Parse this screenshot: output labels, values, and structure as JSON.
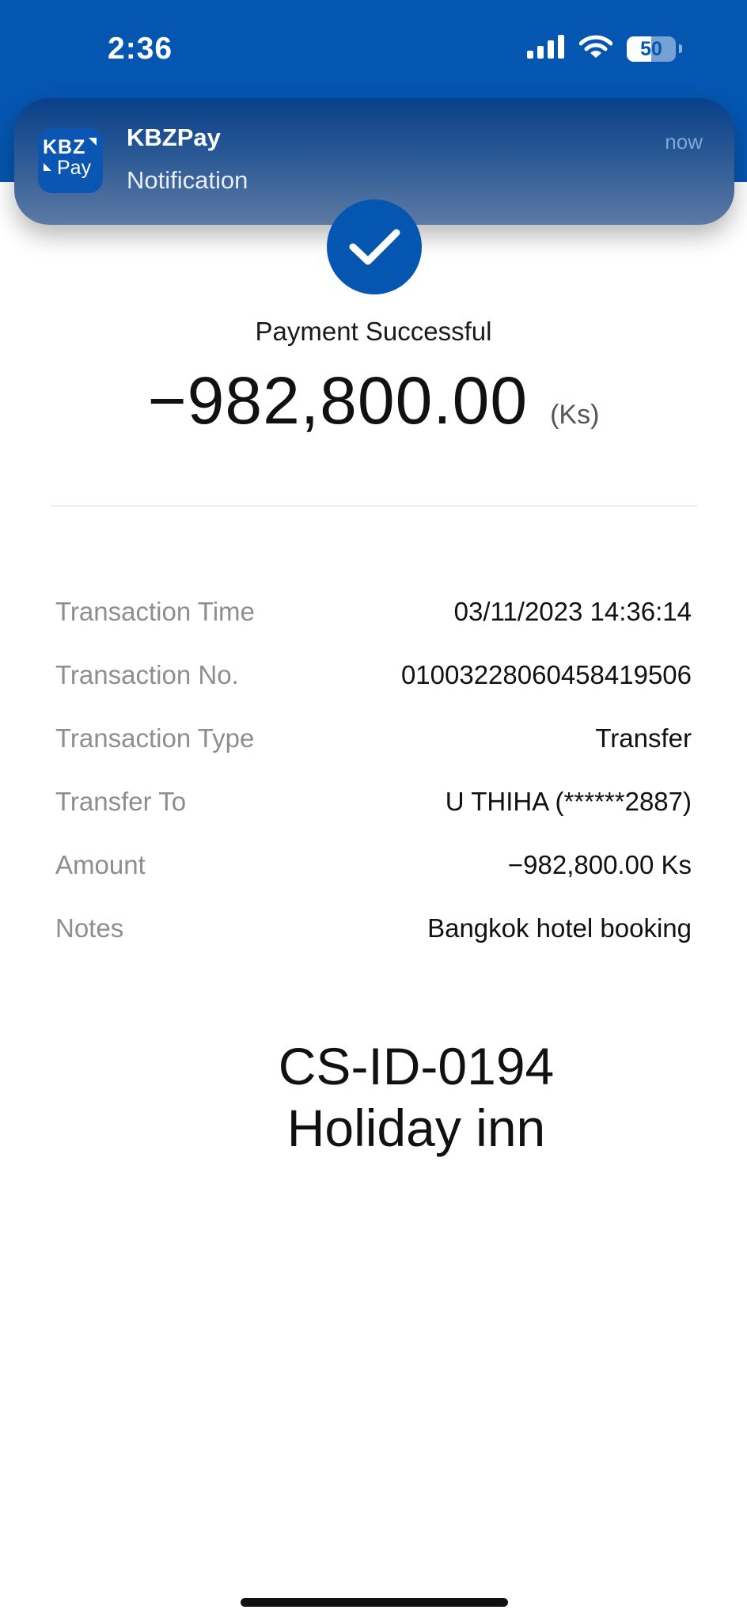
{
  "status_bar": {
    "time": "2:36",
    "battery_level": "50",
    "icons": [
      "cellular-signal-icon",
      "wifi-icon",
      "battery-icon"
    ]
  },
  "notification": {
    "app_name": "KBZPay",
    "message": "Notification",
    "time": "now",
    "app_icon_text_top": "KBZ",
    "app_icon_text_bottom": "Pay"
  },
  "receipt": {
    "status": "Payment Successful",
    "amount": "−982,800.00",
    "currency": "(Ks)",
    "details": [
      {
        "label": "Transaction Time",
        "value": "03/11/2023 14:36:14"
      },
      {
        "label": "Transaction No.",
        "value": "01003228060458419506"
      },
      {
        "label": "Transaction Type",
        "value": "Transfer"
      },
      {
        "label": "Transfer To",
        "value": "U THIHA (******2887)"
      },
      {
        "label": "Amount",
        "value": "−982,800.00 Ks"
      },
      {
        "label": "Notes",
        "value": "Bangkok hotel booking"
      }
    ]
  },
  "annotation": {
    "line1": "CS-ID-0194",
    "line2": "Holiday inn"
  },
  "colors": {
    "brand_blue": "#0556b0",
    "label_gray": "#8e8e8e",
    "text_dark": "#111111"
  }
}
